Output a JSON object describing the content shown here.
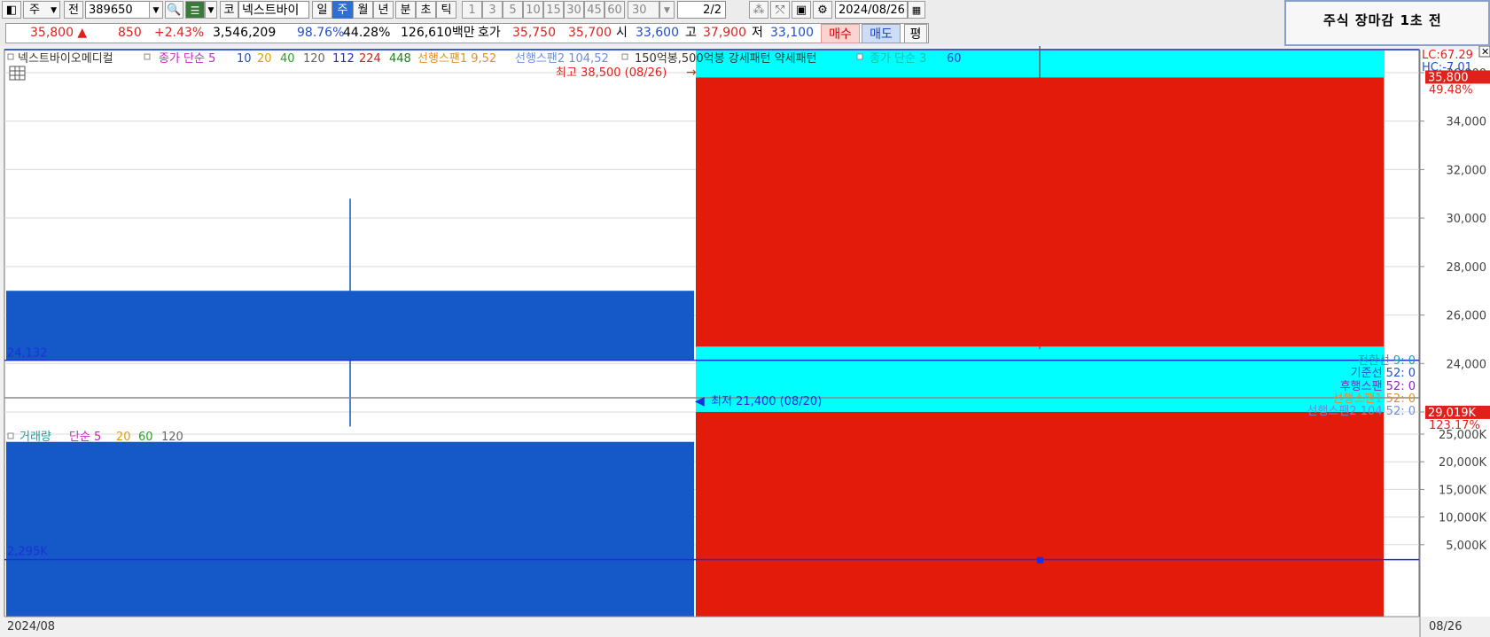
{
  "toolbar": {
    "market_label": "주",
    "prev_label": "전",
    "code": "389650",
    "code_label": "코",
    "name": "넥스트바이",
    "periods": [
      "일",
      "주",
      "월",
      "년",
      "분",
      "초",
      "틱"
    ],
    "selected_period": "주",
    "intervals": [
      "1",
      "3",
      "5",
      "10",
      "15",
      "30",
      "45",
      "60"
    ],
    "interval_select": "30",
    "page": "2/2",
    "date": "2024/08/26"
  },
  "quote": {
    "price": "35,800 ▲",
    "change": "850",
    "change_pct": "+2.43%",
    "volume": "3,546,209",
    "vol_ratio": "98.76%",
    "turnover": "44.28%",
    "amount": "126,610백만",
    "bid_label": "호가",
    "ask": "35,750",
    "bid": "35,700",
    "open_label": "시",
    "open": "33,600",
    "high_label": "고",
    "high": "37,900",
    "low_label": "저",
    "low": "33,100",
    "buy_label": "매수",
    "sell_label": "매도",
    "eval_label": "평"
  },
  "notice": "주식 장마감 1초 전",
  "price_panel": {
    "legend": {
      "name": "넥스트바이오메디컬",
      "ma_label": "종가 단순 5",
      "ma_periods": [
        "10",
        "20",
        "40",
        "120",
        "112",
        "224",
        "448"
      ],
      "span1": "선행스팬1 9,52",
      "span2": "선행스팬2 104,52",
      "pattern": "150억봉,500억봉 강세패턴 약세패턴",
      "ma2_label": "종가 단순 3",
      "ma2_period": "60"
    },
    "high_marker": "최고 38,500 (08/26)",
    "low_marker": "최저 21,400 (08/20)",
    "last_line_label": "24,132",
    "lc": "LC:67.29",
    "hc": "HC:-7.01",
    "current_tag": "35,800",
    "current_pct": "49.48%",
    "yticks": [
      "36,000",
      "34,000",
      "32,000",
      "30,000",
      "28,000",
      "26,000",
      "24,000",
      "22,000"
    ],
    "ichimoku": [
      "전환선 9: 0",
      "기준선 52: 0",
      "후행스팬 52: 0",
      "선행스팬1 52: 0",
      "선행스팬2 104 52: 0"
    ]
  },
  "volume_panel": {
    "legend": {
      "name": "거래량",
      "ma_label": "단순 5",
      "periods": [
        "20",
        "60",
        "120"
      ]
    },
    "last_line_label": "2,295K",
    "current_tag": "29,019K",
    "current_pct": "123.17%",
    "yticks": [
      "25,000K",
      "20,000K",
      "15,000K",
      "10,000K",
      "5,000K"
    ]
  },
  "xaxis": {
    "left_label": "2024/08",
    "right_label": "08/26"
  },
  "colors": {
    "up": "#e31b0b",
    "down": "#1559c9",
    "cloud": "#00ffff"
  },
  "chart_data": {
    "type": "candlestick",
    "candles": [
      {
        "open": 27000,
        "high": 30800,
        "low": 21400,
        "close": 24132
      },
      {
        "open": 24700,
        "high": 38500,
        "low": 24600,
        "close": 35800
      }
    ],
    "volume": [
      23600,
      29019
    ],
    "ylim": [
      21000,
      38600
    ],
    "vol_ylim": [
      0,
      29000
    ]
  }
}
